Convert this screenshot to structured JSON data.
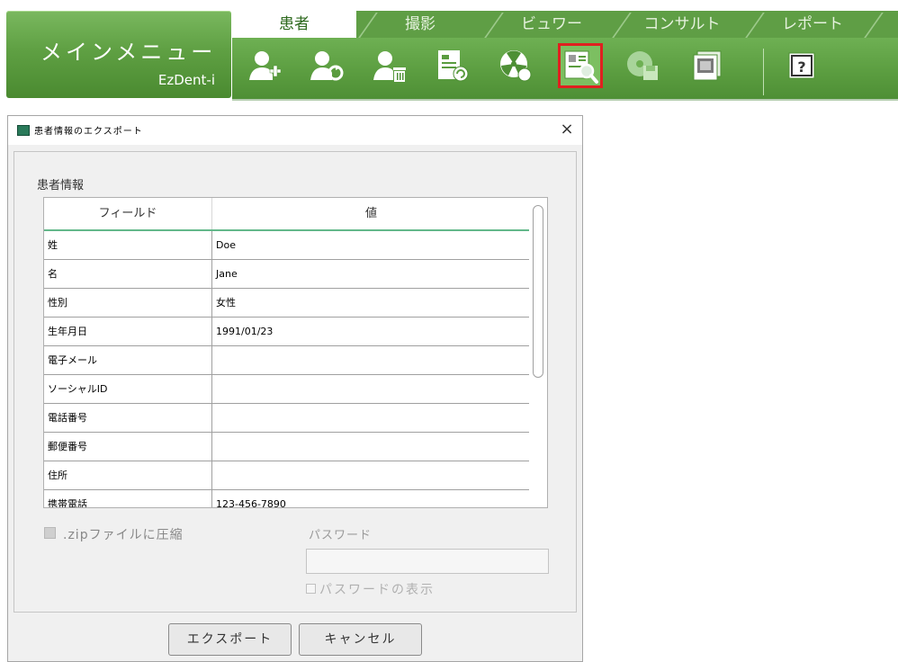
{
  "app": {
    "main_menu_title": "メインメニュー",
    "main_menu_subtitle": "EzDent-i",
    "tabs": [
      {
        "label": "患者",
        "active": true
      },
      {
        "label": "撮影",
        "active": false
      },
      {
        "label": "ビュワー",
        "active": false
      },
      {
        "label": "コンサルト",
        "active": false
      },
      {
        "label": "レポート",
        "active": false
      }
    ],
    "toolbar_icons": [
      "add-patient-icon",
      "edit-patient-icon",
      "delete-patient-icon",
      "patient-record-refresh-icon",
      "radiation-icon",
      "patient-export-icon",
      "disk-save-icon",
      "photo-album-icon",
      "help-icon"
    ],
    "accent": "#5a9c3f",
    "selected_outline": "#e02020"
  },
  "dialog": {
    "title": "患者情報のエクスポート",
    "close_glyph": "×",
    "group_label": "患者情報",
    "columns": {
      "field": "フィールド",
      "value": "値"
    },
    "rows": [
      {
        "field": "姓",
        "value": "Doe"
      },
      {
        "field": "名",
        "value": "Jane"
      },
      {
        "field": "性別",
        "value": "女性"
      },
      {
        "field": "生年月日",
        "value": "1991/01/23"
      },
      {
        "field": "電子メール",
        "value": ""
      },
      {
        "field": "ソーシャルID",
        "value": ""
      },
      {
        "field": "電話番号",
        "value": ""
      },
      {
        "field": "郵便番号",
        "value": ""
      },
      {
        "field": "住所",
        "value": ""
      },
      {
        "field": "携帯電話",
        "value": "123-456-7890"
      }
    ],
    "zip_checkbox_label": ".zipファイルに圧縮",
    "zip_checked": false,
    "password_label": "パスワード",
    "password_value": "",
    "show_password_label": "パスワードの表示",
    "show_password_checked": false,
    "export_button": "エクスポート",
    "cancel_button": "キャンセル"
  }
}
